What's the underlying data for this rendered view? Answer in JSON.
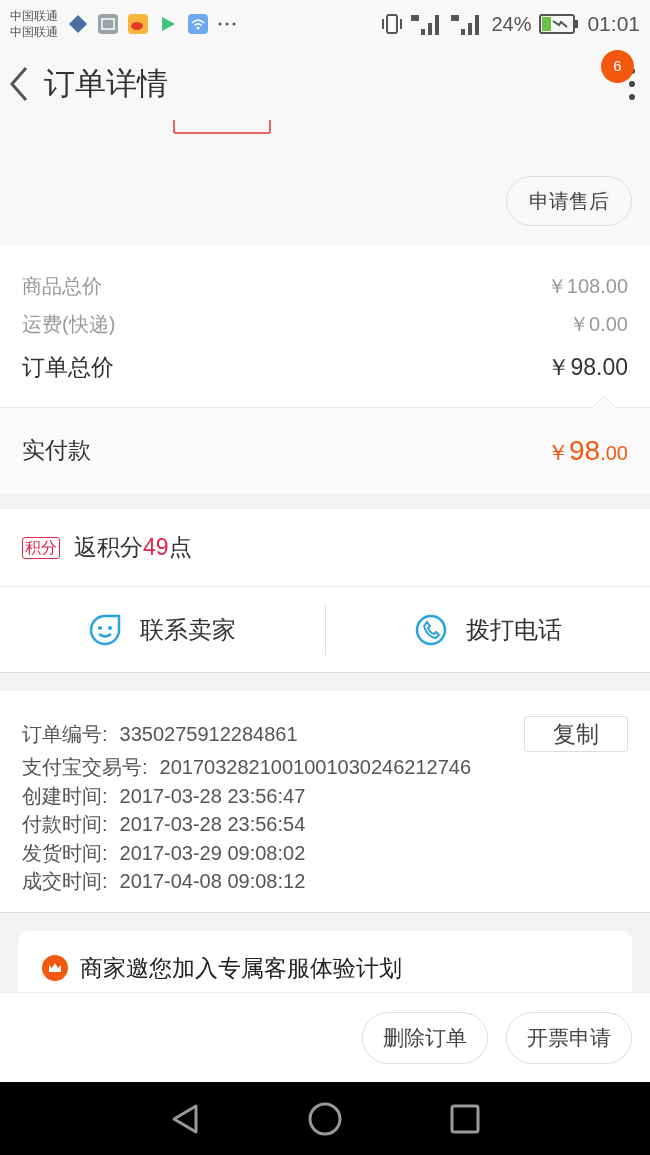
{
  "status_bar": {
    "carriers": [
      "中国联通",
      "中国联通"
    ],
    "battery": "24%",
    "time": "01:01"
  },
  "header": {
    "title": "订单详情",
    "badge": "6"
  },
  "after_sale_button": "申请售后",
  "prices": [
    {
      "label": "商品总价",
      "value": "￥108.00",
      "kind": "minor"
    },
    {
      "label": "运费(快递)",
      "value": "￥0.00",
      "kind": "minor"
    },
    {
      "label": "订单总价",
      "value": "￥98.00",
      "kind": "major"
    }
  ],
  "paid": {
    "label": "实付款",
    "currency": "￥",
    "integer": "98",
    "decimal": ".00"
  },
  "points": {
    "tag": "积分",
    "text": "返积分",
    "number": "49",
    "unit": "点"
  },
  "contact": [
    {
      "label": "联系卖家",
      "kind": "chat"
    },
    {
      "label": "拨打电话",
      "kind": "phone"
    }
  ],
  "order_info": {
    "copy_button": "复制",
    "rows": [
      {
        "label": "订单编号:",
        "value": "3350275912284861"
      },
      {
        "label": "支付宝交易号:",
        "value": "2017032821001001030246212746"
      },
      {
        "label": "创建时间:",
        "value": "2017-03-28 23:56:47"
      },
      {
        "label": "付款时间:",
        "value": "2017-03-28 23:56:54"
      },
      {
        "label": "发货时间:",
        "value": "2017-03-29 09:08:02"
      },
      {
        "label": "成交时间:",
        "value": "2017-04-08 09:08:12"
      }
    ]
  },
  "promo": "商家邀您加入专属客服体验计划",
  "actions": [
    "删除订单",
    "开票申请"
  ]
}
